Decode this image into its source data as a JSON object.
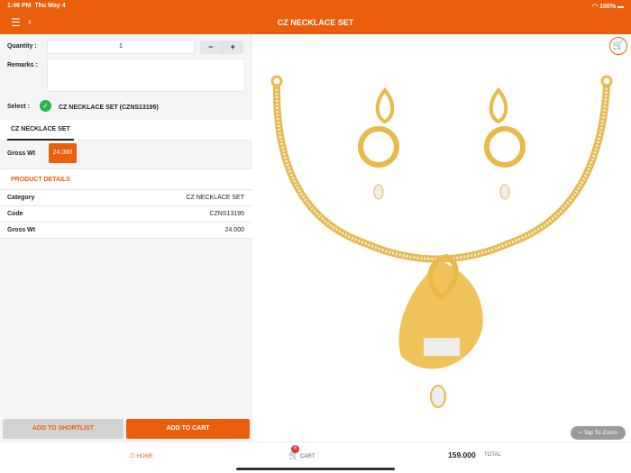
{
  "status": {
    "time": "1:46 PM",
    "date": "Thu May 4",
    "battery": "100%"
  },
  "header": {
    "title": "CZ NECKLACE SET"
  },
  "form": {
    "quantity_label": "Quantity :",
    "quantity_value": "1",
    "minus": "−",
    "plus": "+",
    "remarks_label": "Remarks :",
    "remarks_value": "",
    "select_label": "Select :",
    "select_value": "CZ NECKLACE SET (CZNS13195)"
  },
  "tab": {
    "label": "CZ NECKLACE SET"
  },
  "gross": {
    "label": "Gross Wt",
    "value": "24.000"
  },
  "details": {
    "heading": "PRODUCT DETAILS",
    "rows": [
      {
        "k": "Category",
        "v": "CZ NECKLACE SET"
      },
      {
        "k": "Code",
        "v": "CZNS13195"
      },
      {
        "k": "Gross Wt",
        "v": "24.000"
      }
    ]
  },
  "buttons": {
    "shortlist": "ADD TO SHORTLIST",
    "cart": "ADD TO CART",
    "zoom": "Tap To Zoom"
  },
  "bottom": {
    "home": "HOME",
    "cart": "CART",
    "cart_count": "6",
    "total_value": "159.000",
    "total_label": "TOTAL"
  },
  "colors": {
    "accent": "#eb5e0b"
  }
}
